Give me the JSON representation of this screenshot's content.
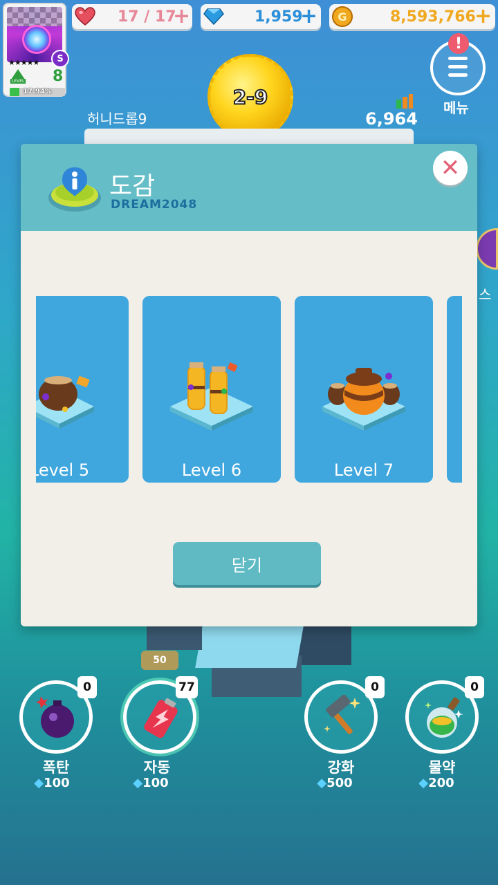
{
  "player": {
    "rank": "S",
    "stars": "★★★★★",
    "level_word": "LEVEL",
    "level": "8",
    "xp_percent": "17.94%",
    "xp_fraction": 0.1794
  },
  "resources": {
    "hearts": "17 / 17",
    "gems": "1,959",
    "coins": "8,593,766",
    "plus": "+"
  },
  "menu": {
    "label": "메뉴",
    "alert": "!"
  },
  "stage": {
    "label": "2-9",
    "name": "허니드롭9",
    "score": "6,964"
  },
  "modal": {
    "title": "도감",
    "subtitle": "DREAM2048",
    "close_x": "✕",
    "close_button": "닫기",
    "cards": [
      {
        "label": "Level 5"
      },
      {
        "label": "Level 6"
      },
      {
        "label": "Level 7"
      },
      {
        "label": ""
      }
    ]
  },
  "side_label": "스",
  "items": [
    {
      "name": "폭탄",
      "count": "0",
      "cost": "100",
      "icon": "bomb-icon"
    },
    {
      "name": "자동",
      "count": "77",
      "cost": "100",
      "icon": "battery-icon",
      "tag": "50"
    },
    {
      "name": "강화",
      "count": "0",
      "cost": "500",
      "icon": "hammer-icon"
    },
    {
      "name": "물약",
      "count": "0",
      "cost": "200",
      "icon": "potion-icon"
    }
  ],
  "colors": {
    "modal_header": "#65bdc7",
    "card": "#3fa6de",
    "accent_green": "#2f9e3e",
    "coin": "#f0a81e",
    "gem": "#2a9be0",
    "heart": "#e6505e"
  }
}
